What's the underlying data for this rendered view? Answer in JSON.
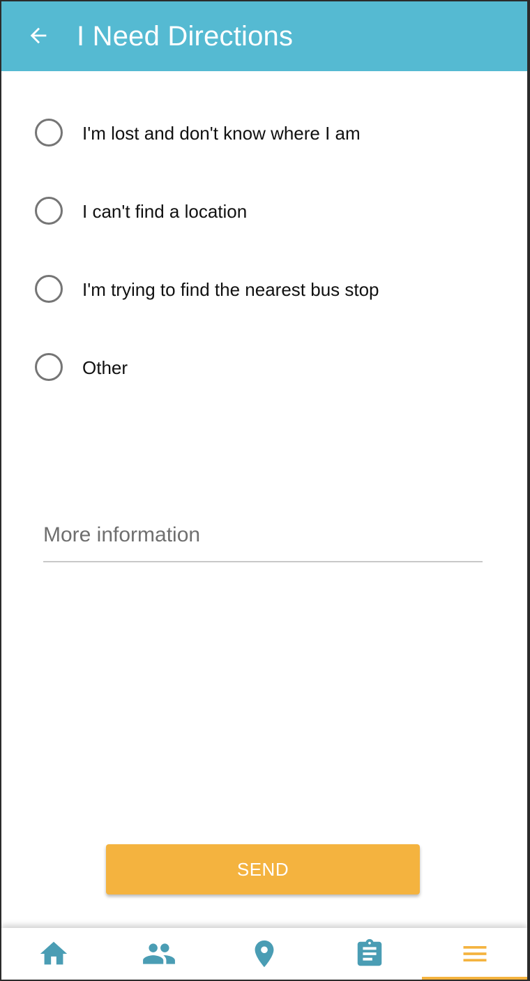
{
  "colors": {
    "accent": "#55BAD2",
    "nav_icon": "#4A9DB4",
    "button": "#F4B33F",
    "active_nav": "#F4B33F"
  },
  "header": {
    "title": "I Need Directions",
    "back_icon": "arrow-back-icon"
  },
  "options": [
    {
      "label": "I'm lost and don't know where I am",
      "selected": false
    },
    {
      "label": "I can't find a location",
      "selected": false
    },
    {
      "label": "I'm trying to find the nearest bus stop",
      "selected": false
    },
    {
      "label": "Other",
      "selected": false
    }
  ],
  "more_info": {
    "placeholder": "More information",
    "value": ""
  },
  "send_label": "SEND",
  "bottom_nav": [
    {
      "icon": "home-icon",
      "active": false
    },
    {
      "icon": "people-icon",
      "active": false
    },
    {
      "icon": "location-pin-icon",
      "active": false
    },
    {
      "icon": "clipboard-icon",
      "active": false
    },
    {
      "icon": "menu-icon",
      "active": true
    }
  ]
}
